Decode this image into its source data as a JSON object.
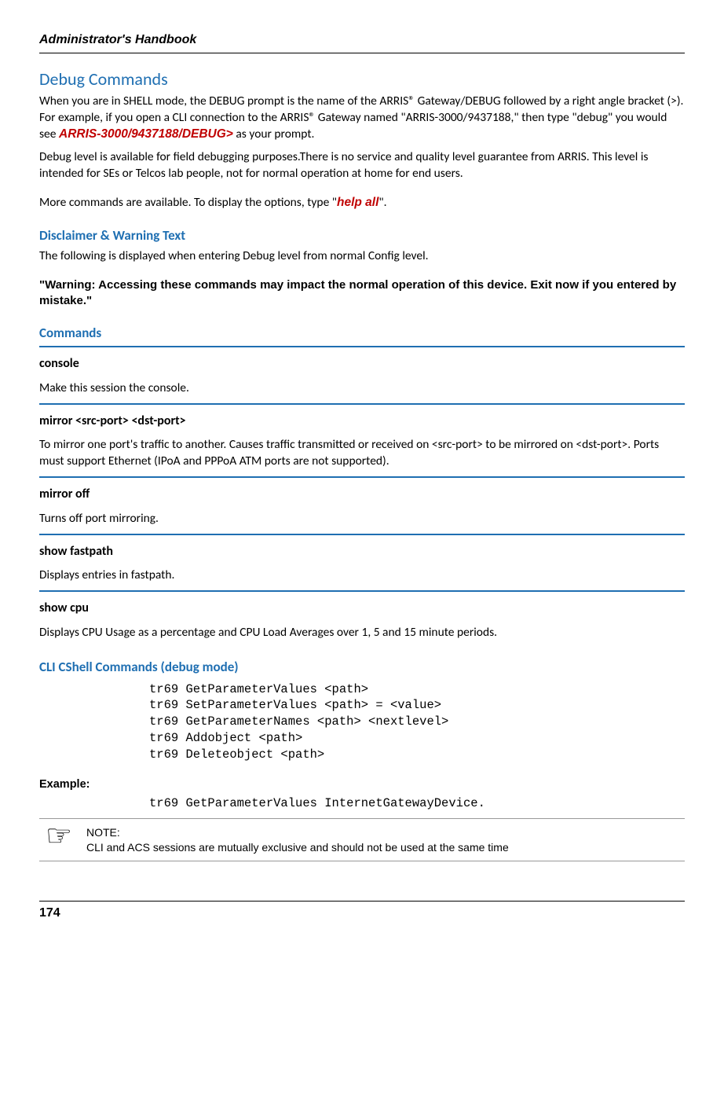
{
  "header": {
    "title": "Administrator's Handbook"
  },
  "section": {
    "h1": "Debug Commands",
    "p1a": "When you are in SHELL mode, the DEBUG prompt is the name of the ARRIS® Gateway/DEBUG followed by a right angle bracket (>). For example, if you open a CLI connection to the ARRIS® Gateway named \"ARRIS-3000/9437188,\" then type \"debug\" you would see ",
    "p1_prompt": "ARRIS-3000/9437188/DEBUG>",
    "p1b": " as your prompt.",
    "p2": "Debug level is available for field debugging purposes.There is no service and quality level guarantee from ARRIS. This level is intended for SEs or Telcos lab people, not for normal operation at home for end users.",
    "p3a": "More commands are available. To display the options, type \"",
    "p3_cmd": "help all",
    "p3b": "\"."
  },
  "disclaimer": {
    "heading": "Disclaimer & Warning Text",
    "body": "The following is displayed when entering Debug level from normal Config level.",
    "warning": "\"Warning: Accessing these commands may impact the normal operation of this device. Exit now if you entered by mistake.\""
  },
  "commands_heading": "Commands",
  "commands": [
    {
      "name": "console",
      "desc": "Make this session the console."
    },
    {
      "name": "mirror <src-port> <dst-port>",
      "desc": "To mirror one port's traffic to another. Causes traffic transmitted or received on <src-port> to be mirrored on <dst-port>. Ports must support Ethernet (IPoA and PPPoA ATM ports are not supported)."
    },
    {
      "name": "mirror off",
      "desc": "Turns off port mirroring."
    },
    {
      "name": "show fastpath",
      "desc": "Displays entries in fastpath."
    },
    {
      "name": "show cpu",
      "desc": "Displays CPU Usage as a percentage and CPU Load Averages over 1, 5 and 15 minute periods."
    }
  ],
  "cli": {
    "heading": " CLI CShell Commands  (debug mode)",
    "block": "tr69 GetParameterValues <path>\ntr69 SetParameterValues <path> = <value>\ntr69 GetParameterNames <path> <nextlevel>\ntr69 Addobject <path>\ntr69 Deleteobject <path>",
    "example_label": "Example:",
    "example_code": "tr69 GetParameterValues InternetGatewayDevice."
  },
  "note": {
    "label": "NOTE:",
    "body": "CLI and ACS sessions are mutually exclusive and should not be used at the same time"
  },
  "footer": {
    "page": "174"
  }
}
